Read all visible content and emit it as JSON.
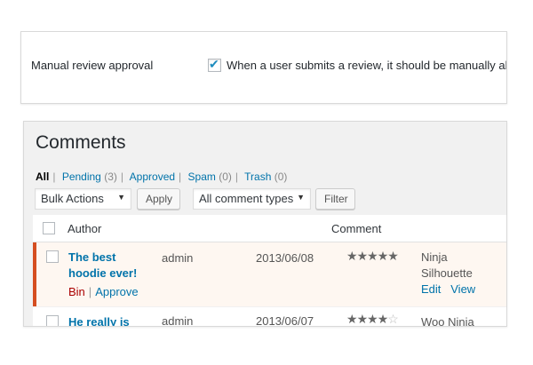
{
  "settings": {
    "label": "Manual review approval",
    "checked": true,
    "description": "When a user submits a review, it should be manually all"
  },
  "comments": {
    "title": "Comments",
    "filters": [
      {
        "label": "All",
        "count": ""
      },
      {
        "label": "Pending",
        "count": "(3)"
      },
      {
        "label": "Approved",
        "count": ""
      },
      {
        "label": "Spam",
        "count": "(0)"
      },
      {
        "label": "Trash",
        "count": "(0)"
      }
    ],
    "bulk_actions": "Bulk Actions",
    "apply_label": "Apply",
    "comment_types": "All comment types",
    "filter_label": "Filter",
    "columns": {
      "author": "Author",
      "comment": "Comment"
    },
    "rows": [
      {
        "title_line1": "The best",
        "title_line2": "hoodie ever!",
        "author": "admin",
        "date": "2013/06/08",
        "rating": 5,
        "product_line1": "Ninja",
        "product_line2": "Silhouette",
        "action_bin": "Bin",
        "action_approve": "Approve",
        "action_edit": "Edit",
        "action_view": "View"
      },
      {
        "title_line1": "He really is",
        "author": "admin",
        "date": "2013/06/07",
        "rating": 4,
        "product_line1": "Woo Ninja"
      }
    ]
  }
}
